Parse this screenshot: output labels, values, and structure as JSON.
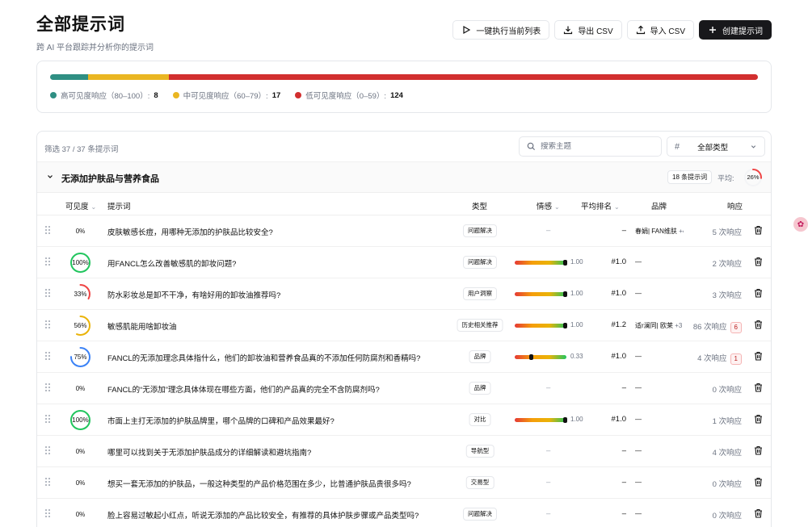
{
  "page": {
    "title": "全部提示词",
    "subtitle": "跨 AI 平台跟踪并分析你的提示词"
  },
  "actions": {
    "run": "一键执行当前列表",
    "export": "导出 CSV",
    "import": "导入 CSV",
    "create": "创建提示词"
  },
  "visibility": {
    "high": {
      "label": "高可见度响应（80–100）:",
      "count": "8",
      "color": "#2f8f83"
    },
    "mid": {
      "label": "中可见度响应（60–79）:",
      "count": "17",
      "color": "#eab622"
    },
    "low": {
      "label": "低可见度响应（0–59）:",
      "count": "124",
      "color": "#d22f2f"
    }
  },
  "filter": {
    "count_text": "筛选 37 / 37 条提示词",
    "search_placeholder": "搜索主题",
    "type_select": "全部类型"
  },
  "group": {
    "name": "无添加护肤品与营养食品",
    "count_badge": "18 条提示词",
    "avg_label": "平均:",
    "avg_value": "26%",
    "avg_fraction": 0.26
  },
  "columns": {
    "visibility": "可见度",
    "prompt": "提示词",
    "type": "类型",
    "sentiment": "情感",
    "avg_rank": "平均排名",
    "brand": "品牌",
    "response": "响应"
  },
  "rows": [
    {
      "visibility": "0%",
      "vis": 0,
      "ring": "#d1d5db",
      "prompt": "皮肤敏感长痘，用哪种无添加的护肤品比较安全?",
      "type": "问题解决",
      "sentiment": null,
      "sentiment_text": "–",
      "rank": "–",
      "brand": "春娟| FAN维肤",
      "brand_more": "+4",
      "responses": "5 次响应",
      "flag": ""
    },
    {
      "visibility": "100%",
      "vis": 1.0,
      "ring": "#22c55e",
      "prompt": "用FANCL怎么改善敏感肌的卸妆问题?",
      "type": "问题解决",
      "sentiment": 1.0,
      "sentiment_text": "1.00",
      "rank": "#1.0",
      "brand": "—",
      "brand_more": "",
      "responses": "2 次响应",
      "flag": ""
    },
    {
      "visibility": "33%",
      "vis": 0.33,
      "ring": "#ef4444",
      "prompt": "防水彩妆总是卸不干净，有啥好用的卸妆油推荐吗?",
      "type": "用户洞察",
      "sentiment": 1.0,
      "sentiment_text": "1.00",
      "rank": "#1.0",
      "brand": "—",
      "brand_more": "",
      "responses": "3 次响应",
      "flag": ""
    },
    {
      "visibility": "56%",
      "vis": 0.56,
      "ring": "#eab308",
      "prompt": "敏感肌能用啥卸妆油",
      "type": "历史相关推荐",
      "sentiment": 1.0,
      "sentiment_text": "1.00",
      "rank": "#1.2",
      "brand": "适r澜同| 欧莱",
      "brand_more": "+3",
      "responses": "86 次响应",
      "flag": "6"
    },
    {
      "visibility": "75%",
      "vis": 0.75,
      "ring": "#3b82f6",
      "prompt": "FANCL的无添加理念具体指什么，他们的卸妆油和营养食品真的不添加任何防腐剂和香精吗?",
      "type": "品牌",
      "sentiment": 0.33,
      "sentiment_text": "0.33",
      "rank": "#1.0",
      "brand": "—",
      "brand_more": "",
      "responses": "4 次响应",
      "flag": "1"
    },
    {
      "visibility": "0%",
      "vis": 0,
      "ring": "#d1d5db",
      "prompt": "FANCL的“无添加”理念具体体现在哪些方面，他们的产品真的完全不含防腐剂吗?",
      "type": "品牌",
      "sentiment": null,
      "sentiment_text": "–",
      "rank": "–",
      "brand": "—",
      "brand_more": "",
      "responses": "0 次响应",
      "flag": ""
    },
    {
      "visibility": "100%",
      "vis": 1.0,
      "ring": "#22c55e",
      "prompt": "市面上主打无添加的护肤品牌里，哪个品牌的口碑和产品效果最好?",
      "type": "对比",
      "sentiment": 1.0,
      "sentiment_text": "1.00",
      "rank": "#1.0",
      "brand": "—",
      "brand_more": "",
      "responses": "1 次响应",
      "flag": ""
    },
    {
      "visibility": "0%",
      "vis": 0,
      "ring": "#d1d5db",
      "prompt": "哪里可以找到关于无添加护肤品成分的详细解读和避坑指南?",
      "type": "导航型",
      "sentiment": null,
      "sentiment_text": "–",
      "rank": "–",
      "brand": "—",
      "brand_more": "",
      "responses": "4 次响应",
      "flag": ""
    },
    {
      "visibility": "0%",
      "vis": 0,
      "ring": "#d1d5db",
      "prompt": "想买一套无添加的护肤品，一般这种类型的产品价格范围在多少，比普通护肤品贵很多吗?",
      "type": "交易型",
      "sentiment": null,
      "sentiment_text": "–",
      "rank": "–",
      "brand": "—",
      "brand_more": "",
      "responses": "0 次响应",
      "flag": ""
    },
    {
      "visibility": "0%",
      "vis": 0,
      "ring": "#d1d5db",
      "prompt": "脸上容易过敏起小红点，听说无添加的产品比较安全，有推荐的具体护肤步骤或产品类型吗?",
      "type": "问题解决",
      "sentiment": null,
      "sentiment_text": "–",
      "rank": "–",
      "brand": "—",
      "brand_more": "",
      "responses": "0 次响应",
      "flag": ""
    }
  ],
  "icons": {
    "run": "play-icon",
    "export": "download-icon",
    "import": "upload-icon",
    "create": "plus-icon",
    "search": "search-icon",
    "type": "hash-icon",
    "row_handle": "grip-icon",
    "row_delete": "trash-icon"
  }
}
